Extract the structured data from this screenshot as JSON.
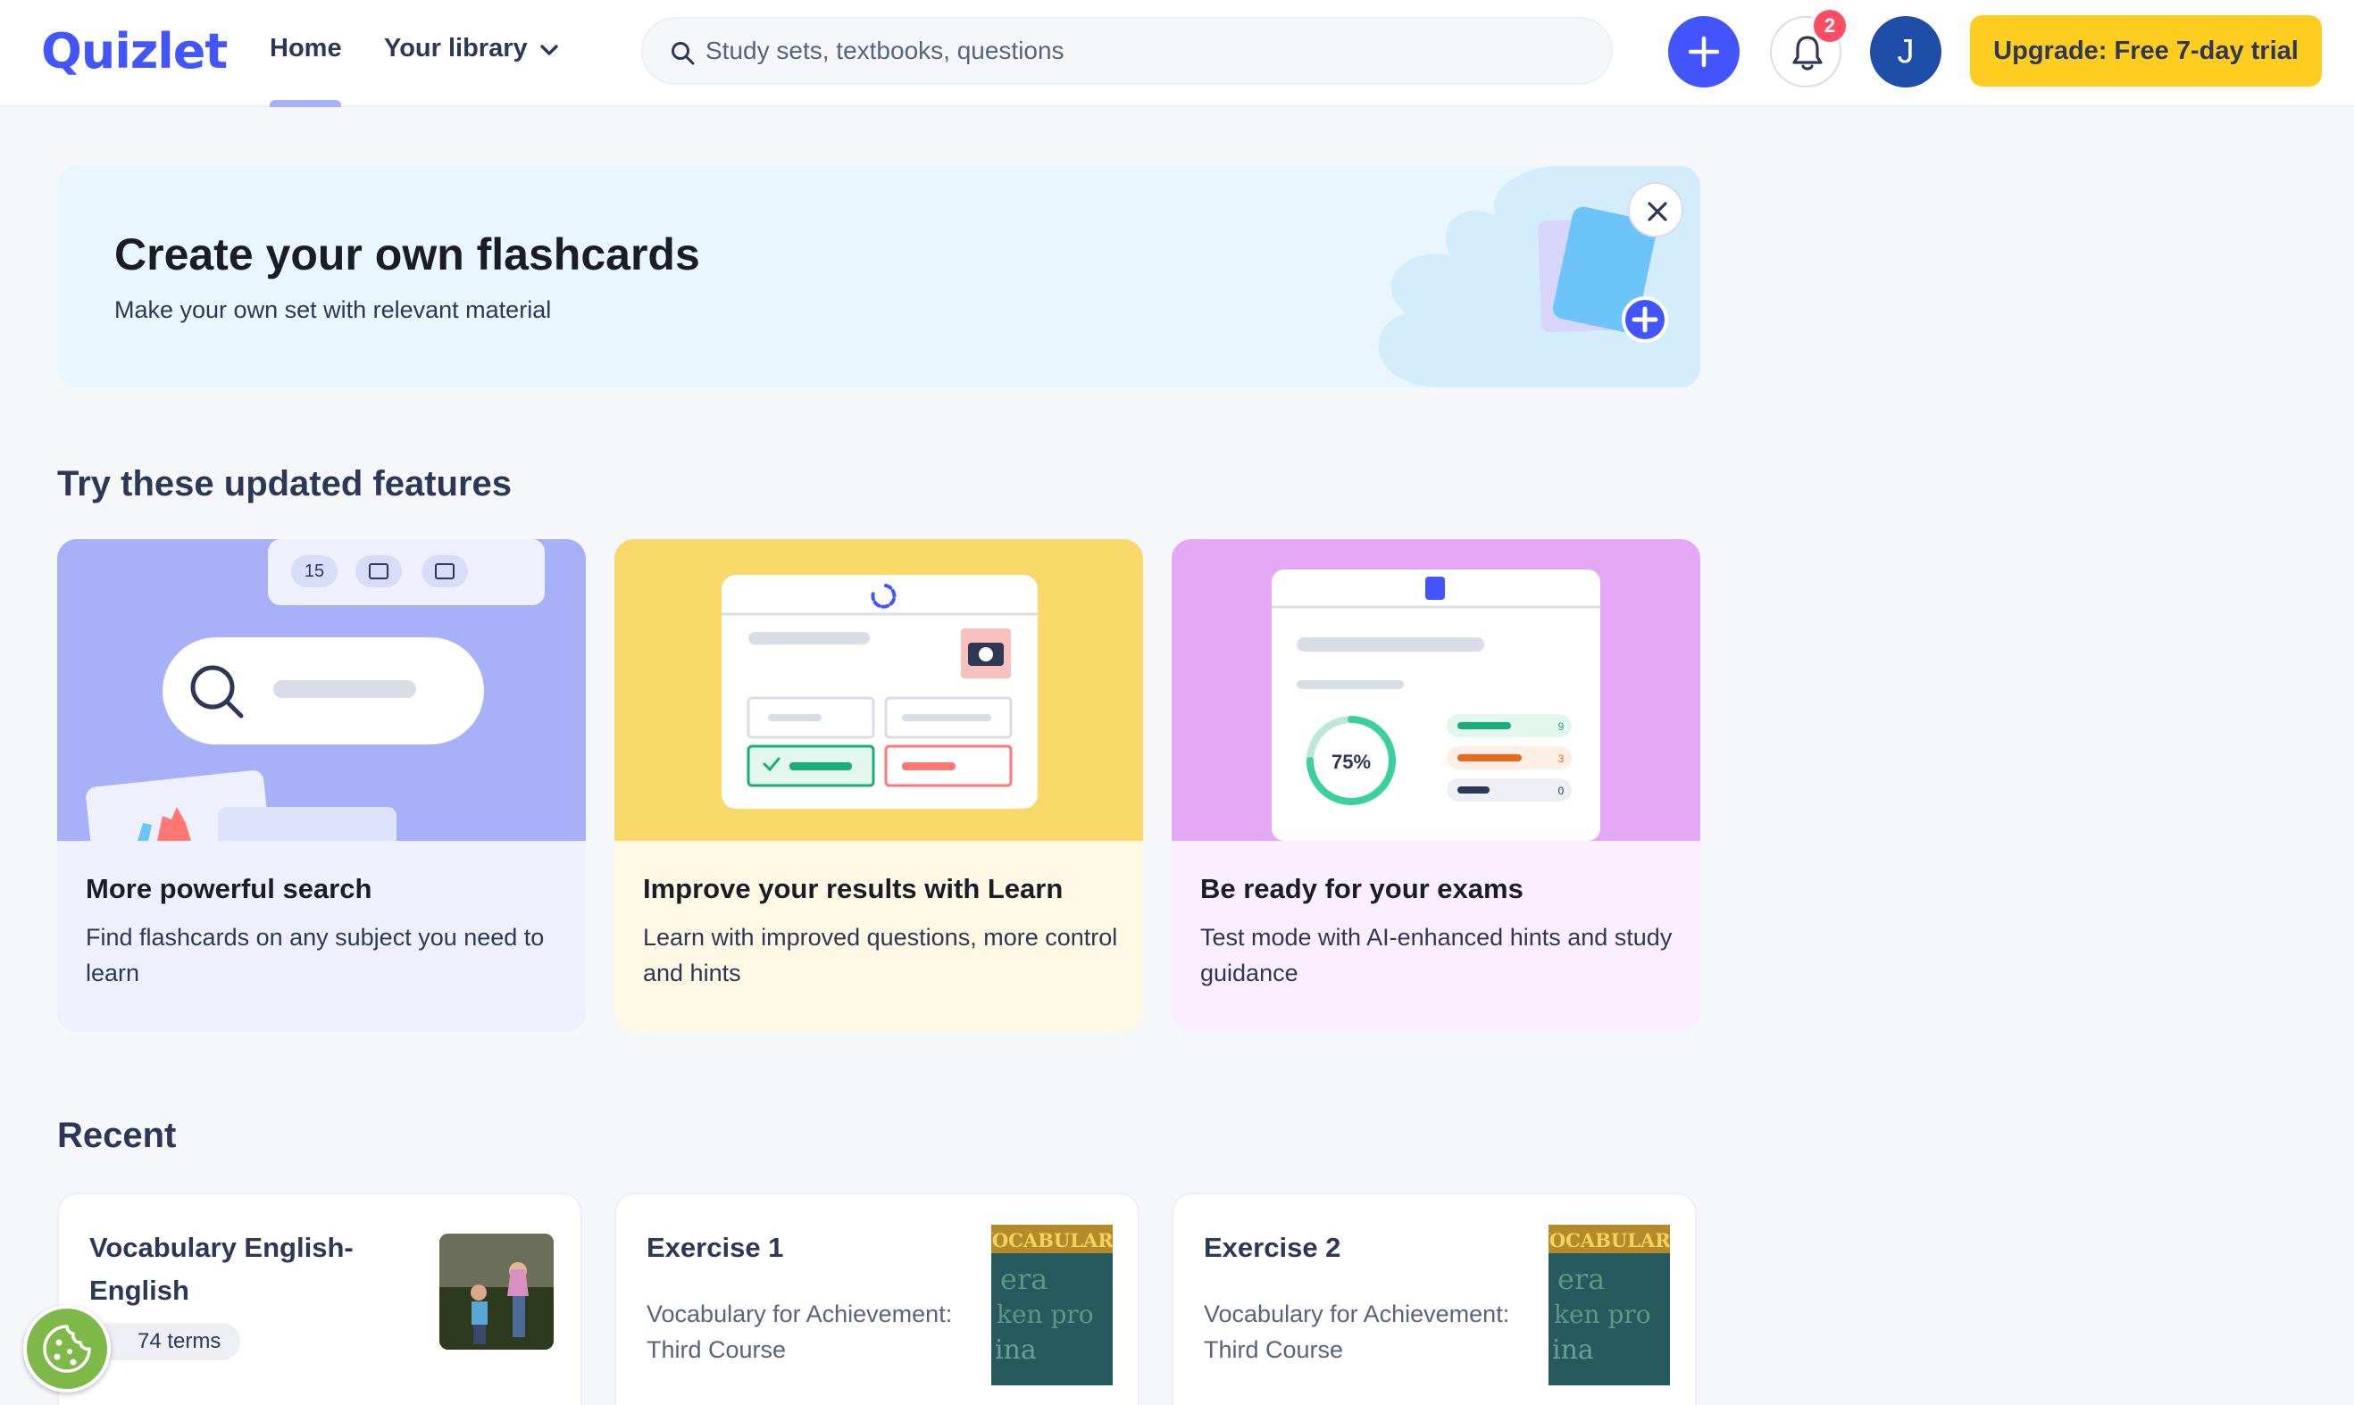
{
  "brand": {
    "logo_text": "Quizlet",
    "accent": "#4255ff",
    "upgrade_color": "#ffcd1f"
  },
  "nav": {
    "home_label": "Home",
    "library_label": "Your library",
    "search_placeholder": "Study sets, textbooks, questions",
    "notification_count": "2",
    "avatar_initial": "J",
    "upgrade_label": "Upgrade: Free 7-day trial"
  },
  "promo": {
    "title": "Create your own flashcards",
    "subtitle": "Make your own set with relevant material"
  },
  "features": {
    "section_title": "Try these updated features",
    "cards": [
      {
        "title": "More powerful search",
        "description": "Find flashcards on any subject you need to learn",
        "art_counter": "15"
      },
      {
        "title": "Improve your results with Learn",
        "description": "Learn with improved questions, more control and hints"
      },
      {
        "title": "Be ready for your exams",
        "description": "Test mode with AI-enhanced hints and study guidance",
        "score": "75%",
        "stats": [
          "9",
          "3",
          "0"
        ]
      }
    ]
  },
  "recent": {
    "section_title": "Recent",
    "items": [
      {
        "name": "Vocabulary English-English",
        "terms": "74 terms"
      },
      {
        "name": "Exercise 1",
        "subtitle": "Vocabulary for Achievement: Third Course",
        "book_title": "VOCABULARY"
      },
      {
        "name": "Exercise 2",
        "subtitle": "Vocabulary for Achievement: Third Course",
        "book_title": "VOCABULARY"
      }
    ]
  }
}
